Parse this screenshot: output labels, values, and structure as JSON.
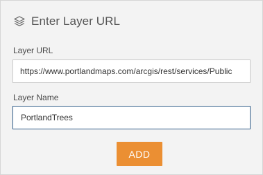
{
  "dialog": {
    "title": "Enter Layer URL",
    "icon": "layers-icon"
  },
  "layer_url": {
    "label": "Layer URL",
    "value": "https://www.portlandmaps.com/arcgis/rest/services/Public"
  },
  "layer_name": {
    "label": "Layer Name",
    "value": "PortlandTrees"
  },
  "add_button": {
    "label": "ADD",
    "color": "#eb8f33"
  }
}
